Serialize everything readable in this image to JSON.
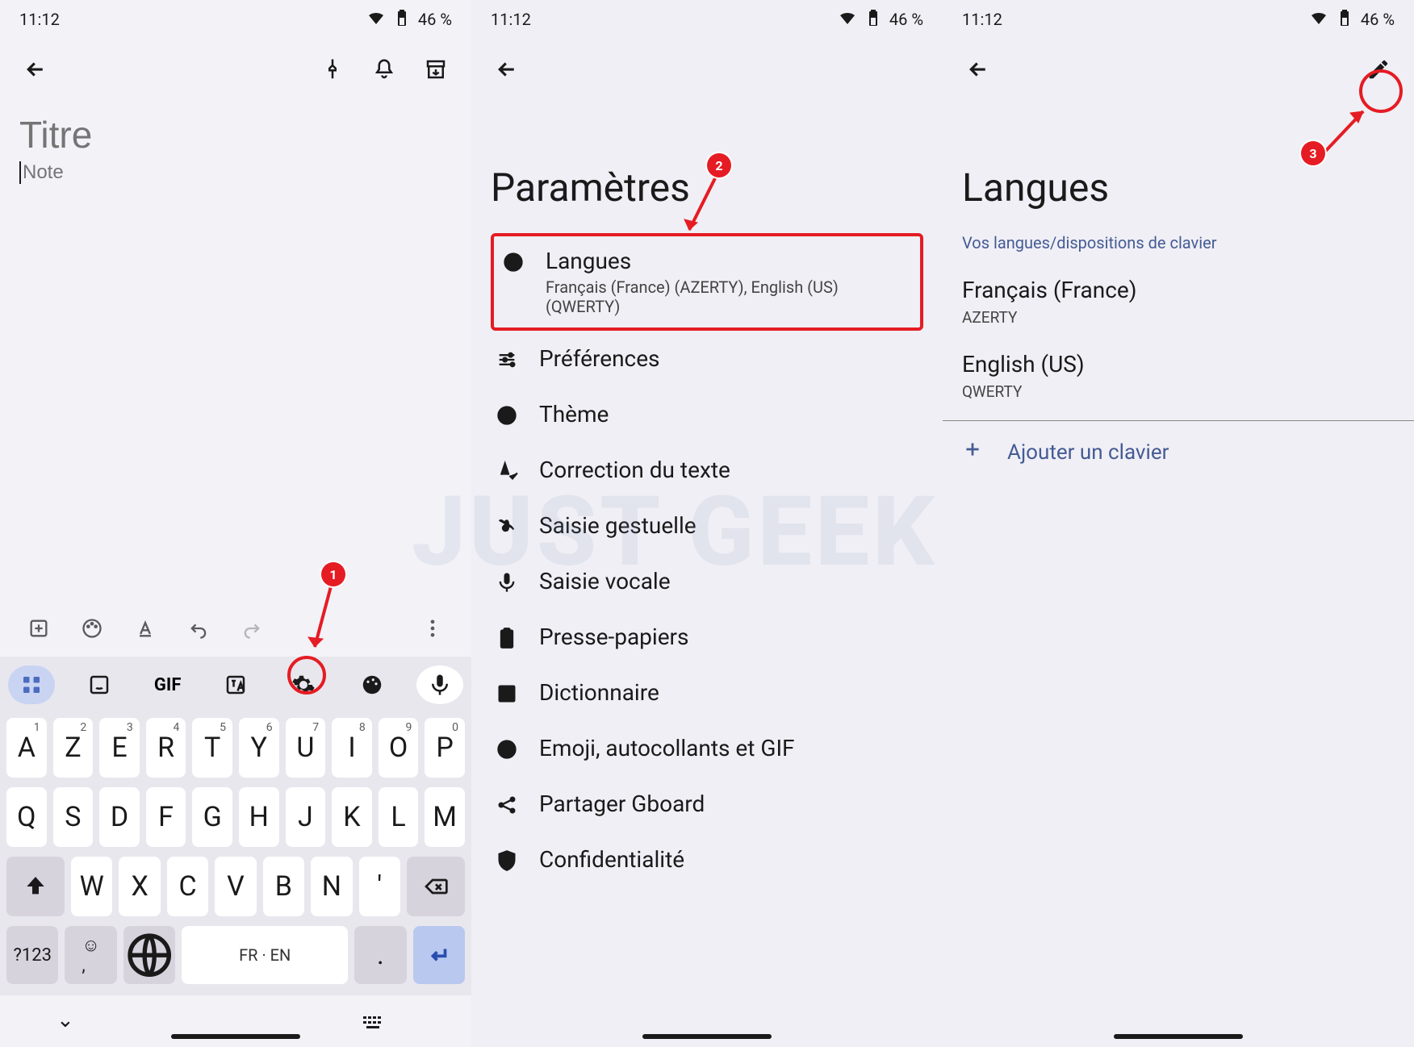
{
  "status": {
    "time": "11:12",
    "battery": "46 %"
  },
  "pane1": {
    "title_placeholder": "Titre",
    "note_placeholder": "Note",
    "kbd": {
      "gif": "GIF",
      "row1": [
        {
          "l": "A",
          "s": "1"
        },
        {
          "l": "Z",
          "s": "2"
        },
        {
          "l": "E",
          "s": "3"
        },
        {
          "l": "R",
          "s": "4"
        },
        {
          "l": "T",
          "s": "5"
        },
        {
          "l": "Y",
          "s": "6"
        },
        {
          "l": "U",
          "s": "7"
        },
        {
          "l": "I",
          "s": "8"
        },
        {
          "l": "O",
          "s": "9"
        },
        {
          "l": "P",
          "s": "0"
        }
      ],
      "row2": [
        "Q",
        "S",
        "D",
        "F",
        "G",
        "H",
        "J",
        "K",
        "L",
        "M"
      ],
      "row3": [
        "W",
        "X",
        "C",
        "V",
        "B",
        "N",
        "'"
      ],
      "q123": "?123",
      "space": "FR · EN",
      "dot": "."
    }
  },
  "pane2": {
    "title": "Paramètres",
    "langues": {
      "title": "Langues",
      "sub": "Français (France) (AZERTY), English (US) (QWERTY)"
    },
    "items": [
      "Préférences",
      "Thème",
      "Correction du texte",
      "Saisie gestuelle",
      "Saisie vocale",
      "Presse-papiers",
      "Dictionnaire",
      "Emoji, autocollants et GIF",
      "Partager Gboard",
      "Confidentialité"
    ]
  },
  "pane3": {
    "title": "Langues",
    "section": "Vos langues/dispositions de clavier",
    "langs": [
      {
        "name": "Français (France)",
        "layout": "AZERTY"
      },
      {
        "name": "English (US)",
        "layout": "QWERTY"
      }
    ],
    "add": "Ajouter un clavier"
  },
  "annotations": {
    "b1": "1",
    "b2": "2",
    "b3": "3"
  },
  "watermark": "JUST GEEK"
}
